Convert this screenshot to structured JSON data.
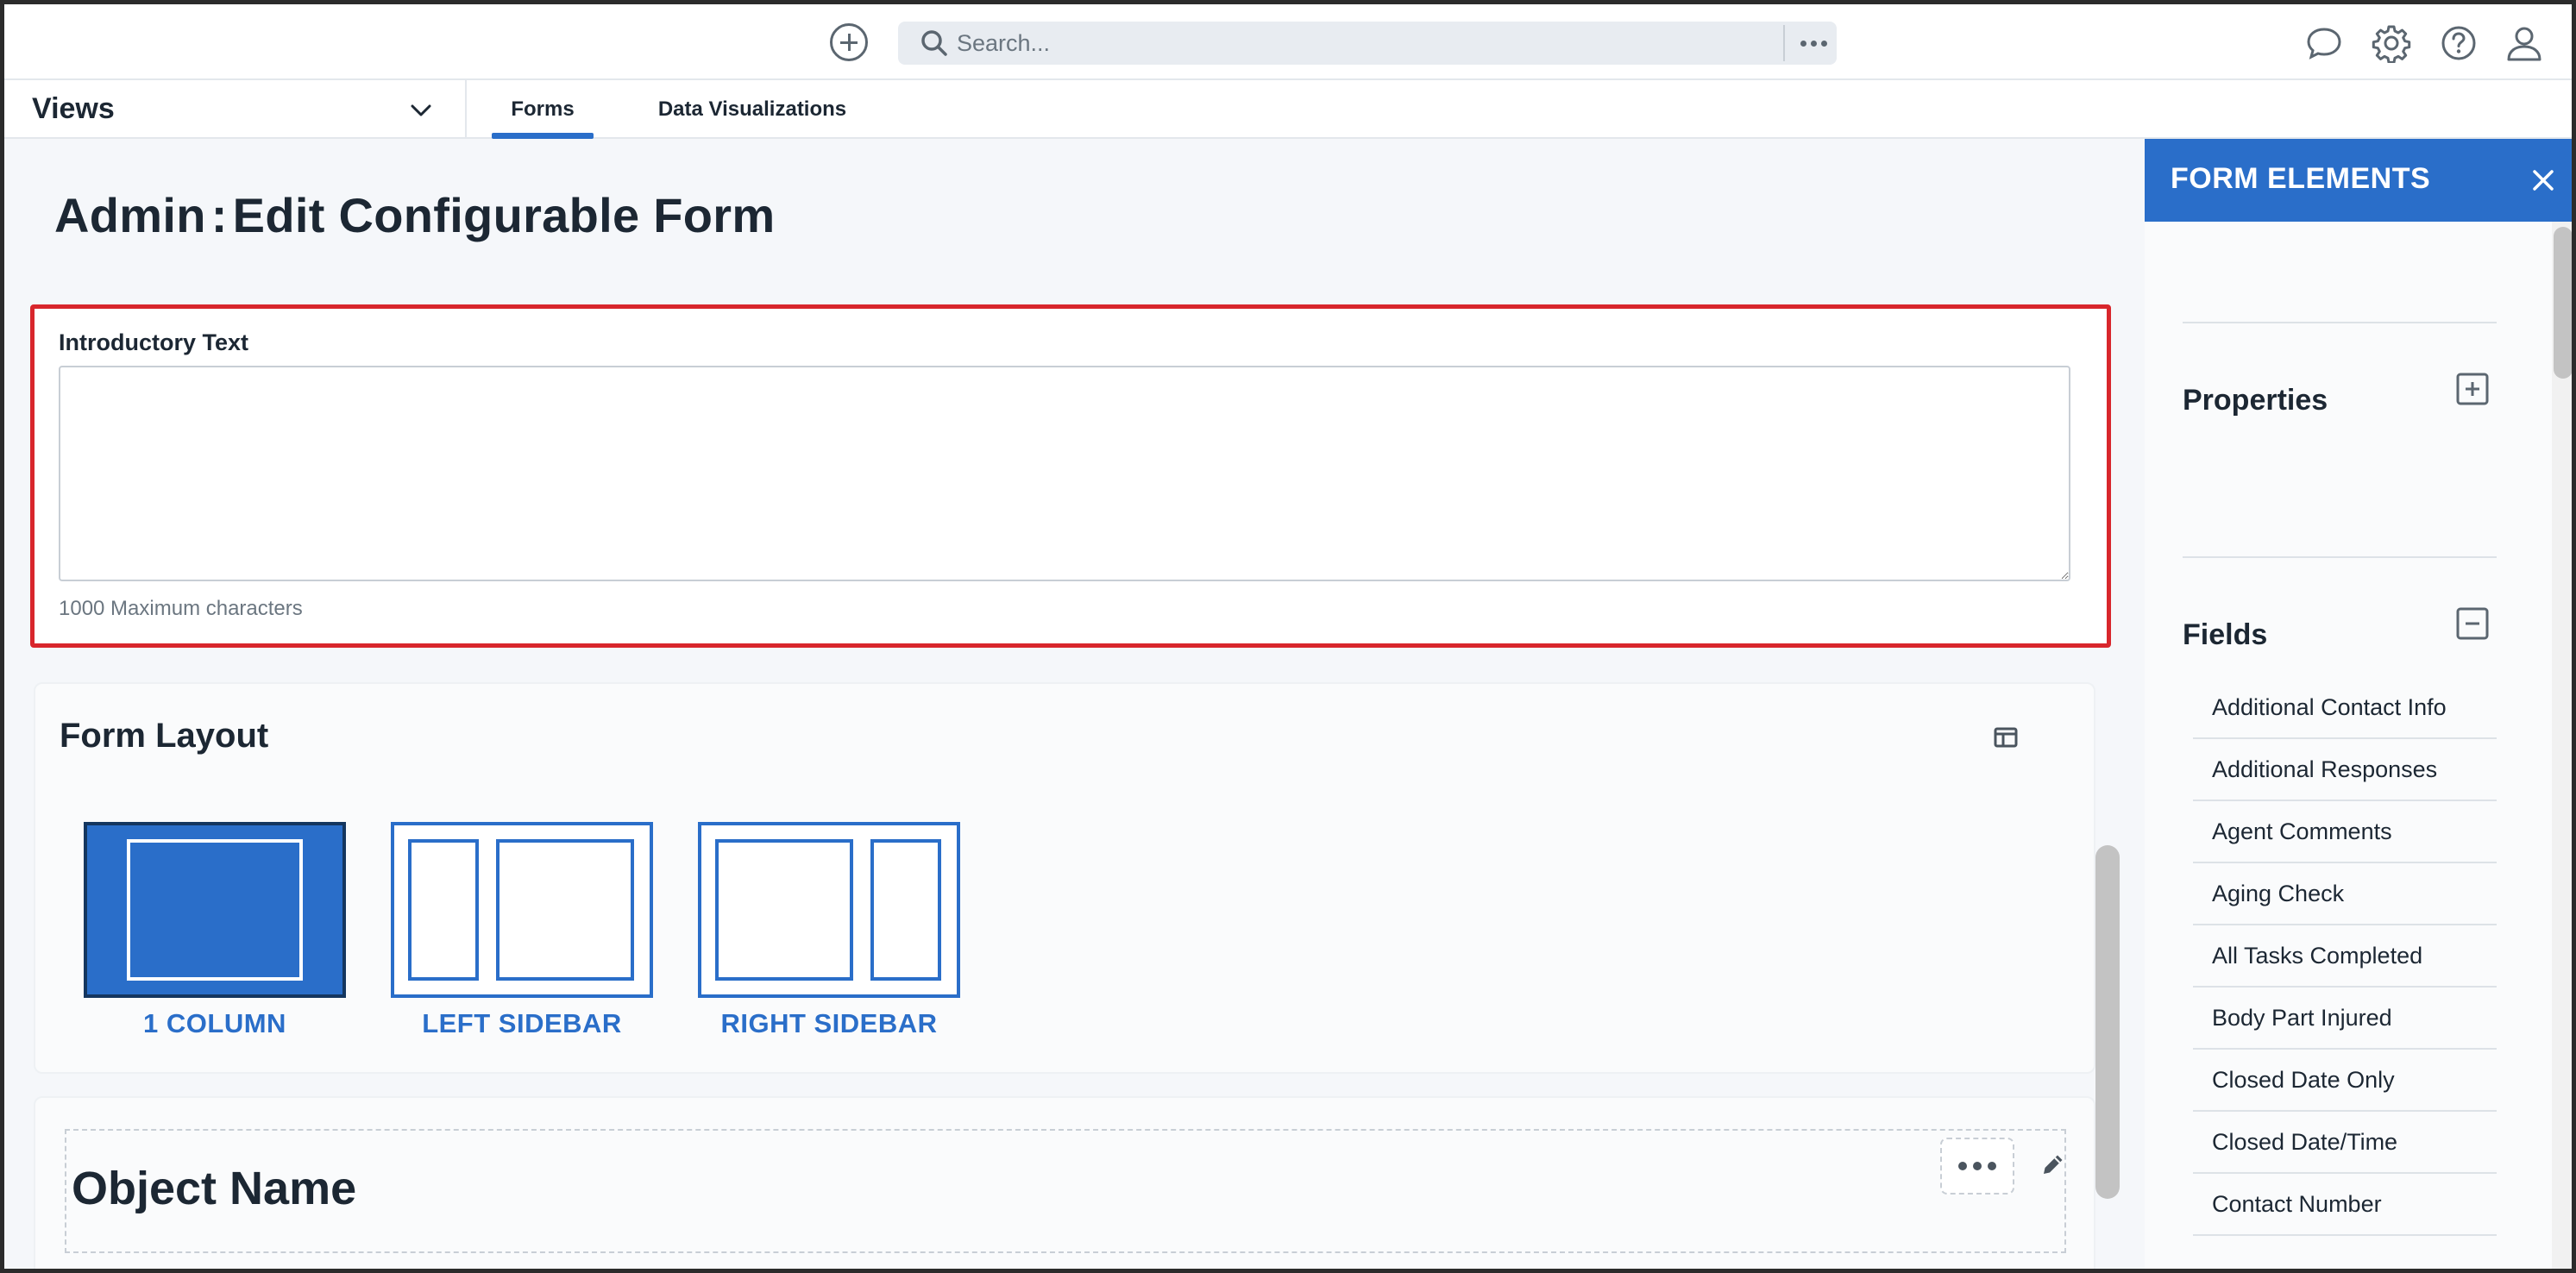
{
  "topbar": {
    "search_placeholder": "Search...",
    "icons": [
      "add-circle-icon",
      "search-icon",
      "more-icon",
      "chat-icon",
      "gear-icon",
      "help-icon",
      "user-icon"
    ]
  },
  "nav": {
    "views_label": "Views",
    "tabs": [
      {
        "label": "Forms",
        "active": true
      },
      {
        "label": "Data Visualizations",
        "active": false
      }
    ]
  },
  "page": {
    "title_prefix": "Admin",
    "title_separator": ":",
    "title": "Edit Configurable Form"
  },
  "intro": {
    "label": "Introductory Text",
    "value": "",
    "hint": "1000 Maximum characters"
  },
  "form_layout": {
    "title": "Form Layout",
    "options": [
      {
        "label": "1 COLUMN",
        "selected": true
      },
      {
        "label": "LEFT SIDEBAR",
        "selected": false
      },
      {
        "label": "RIGHT SIDEBAR",
        "selected": false
      }
    ]
  },
  "object": {
    "name": "Object Name"
  },
  "panel": {
    "title": "FORM ELEMENTS",
    "properties_title": "Properties",
    "fields_title": "Fields",
    "fields": [
      "Additional Contact Info",
      "Additional Responses",
      "Agent Comments",
      "Aging Check",
      "All Tasks Completed",
      "Body Part Injured",
      "Closed Date Only",
      "Closed Date/Time",
      "Contact Number"
    ]
  },
  "colors": {
    "accent": "#2a6ec9",
    "highlight_border": "#d8262c",
    "text": "#1c2733"
  }
}
